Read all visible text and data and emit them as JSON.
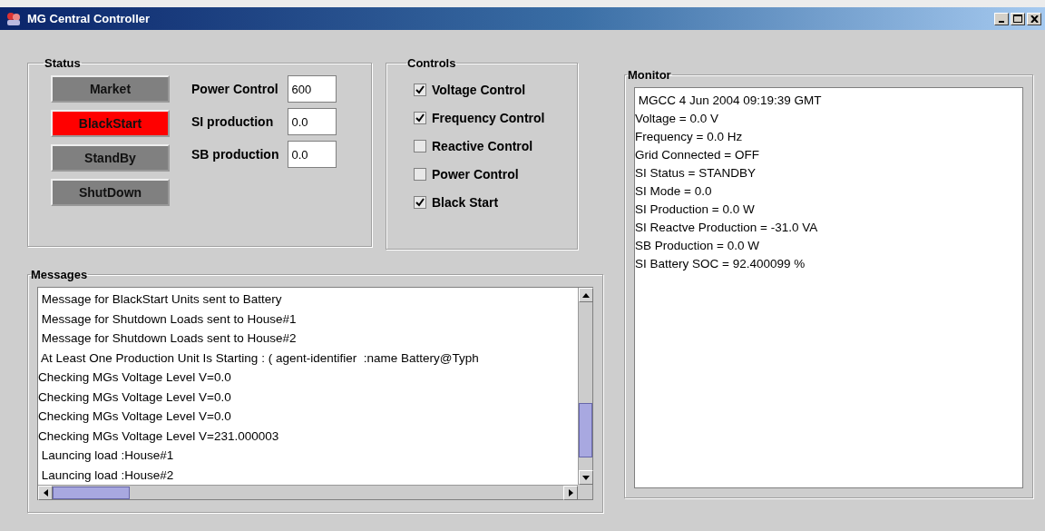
{
  "window": {
    "title": "MG Central Controller"
  },
  "status": {
    "title": "Status",
    "buttons": [
      {
        "label": "Market",
        "active": false
      },
      {
        "label": "BlackStart",
        "active": true
      },
      {
        "label": "StandBy",
        "active": false
      },
      {
        "label": "ShutDown",
        "active": false
      }
    ],
    "fields": [
      {
        "label": "Power Control",
        "value": "600"
      },
      {
        "label": "SI production",
        "value": "0.0"
      },
      {
        "label": "SB production",
        "value": "0.0"
      }
    ]
  },
  "controls": {
    "title": "Controls",
    "items": [
      {
        "label": "Voltage Control",
        "checked": true
      },
      {
        "label": "Frequency Control",
        "checked": true
      },
      {
        "label": "Reactive Control",
        "checked": false
      },
      {
        "label": "Power Control",
        "checked": false
      },
      {
        "label": "Black Start",
        "checked": true
      }
    ]
  },
  "messages": {
    "title": "Messages",
    "lines": [
      " Message for BlackStart Units sent to Battery",
      " Message for Shutdown Loads sent to House#1",
      " Message for Shutdown Loads sent to House#2",
      " At Least One Production Unit Is Starting : ( agent-identifier  :name Battery@Typh",
      "Checking MGs Voltage Level V=0.0",
      "Checking MGs Voltage Level V=0.0",
      "Checking MGs Voltage Level V=0.0",
      "Checking MGs Voltage Level V=231.000003",
      " Launcing load :House#1",
      " Launcing load :House#2"
    ]
  },
  "monitor": {
    "title": "Monitor",
    "lines": [
      " MGCC 4 Jun 2004 09:19:39 GMT",
      "Voltage = 0.0 V",
      "Frequency = 0.0 Hz",
      "Grid Connected = OFF",
      "SI Status = STANDBY",
      "SI Mode = 0.0",
      "SI Production = 0.0 W",
      "SI Reactve Production = -31.0 VA",
      "SB Production = 0.0 W",
      "SI Battery SOC = 92.400099 %"
    ]
  }
}
